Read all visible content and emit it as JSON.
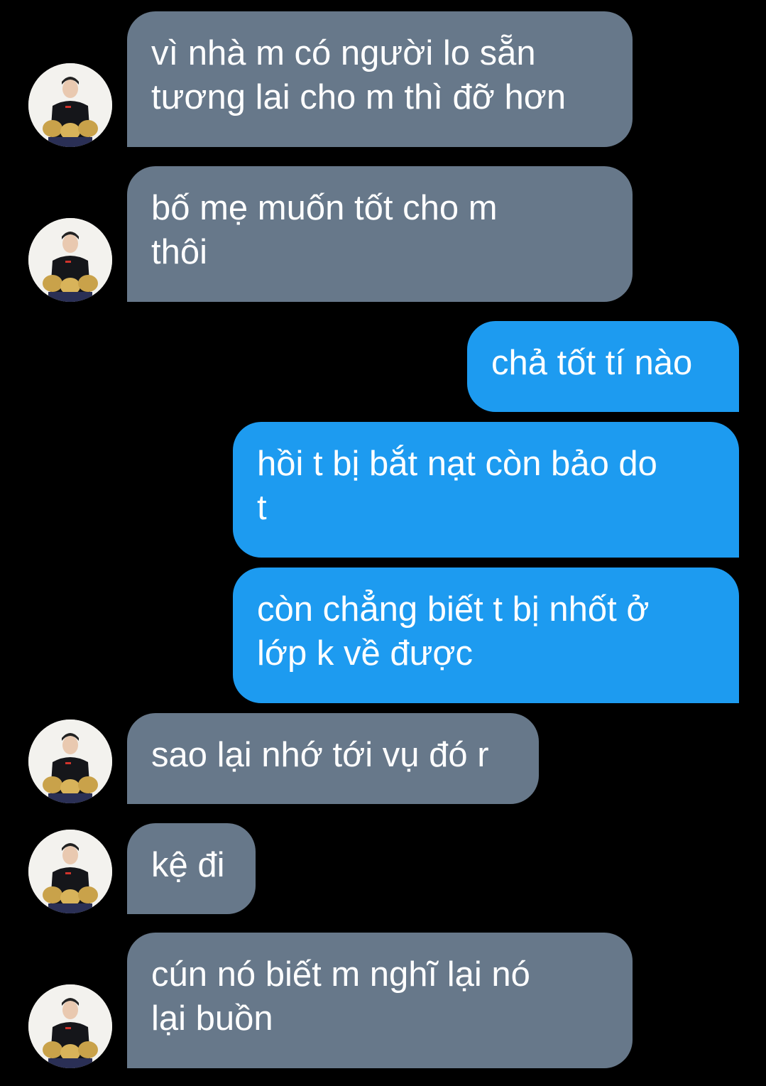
{
  "colors": {
    "background": "#000000",
    "incoming_bubble": "#67788a",
    "outgoing_bubble": "#1d9bf0",
    "text": "#ffffff"
  },
  "avatar_icon": "person-with-trophies-avatar",
  "messages": [
    {
      "direction": "incoming",
      "text": "vì nhà m có người lo sẵn\ntương lai cho m thì đỡ hơn"
    },
    {
      "direction": "incoming",
      "text": "bố mẹ muốn tốt cho m\nthôi"
    },
    {
      "direction": "outgoing",
      "text": "chả tốt tí nào"
    },
    {
      "direction": "outgoing",
      "text": "hồi t bị bắt nạt còn bảo do\nt"
    },
    {
      "direction": "outgoing",
      "text": "còn chẳng biết t bị nhốt ở\nlớp k về được"
    },
    {
      "direction": "incoming",
      "text": "sao lại nhớ tới vụ đó r"
    },
    {
      "direction": "incoming",
      "text": "kệ đi"
    },
    {
      "direction": "incoming",
      "text": "cún nó biết m nghĩ lại nó\nlại buồn"
    }
  ]
}
